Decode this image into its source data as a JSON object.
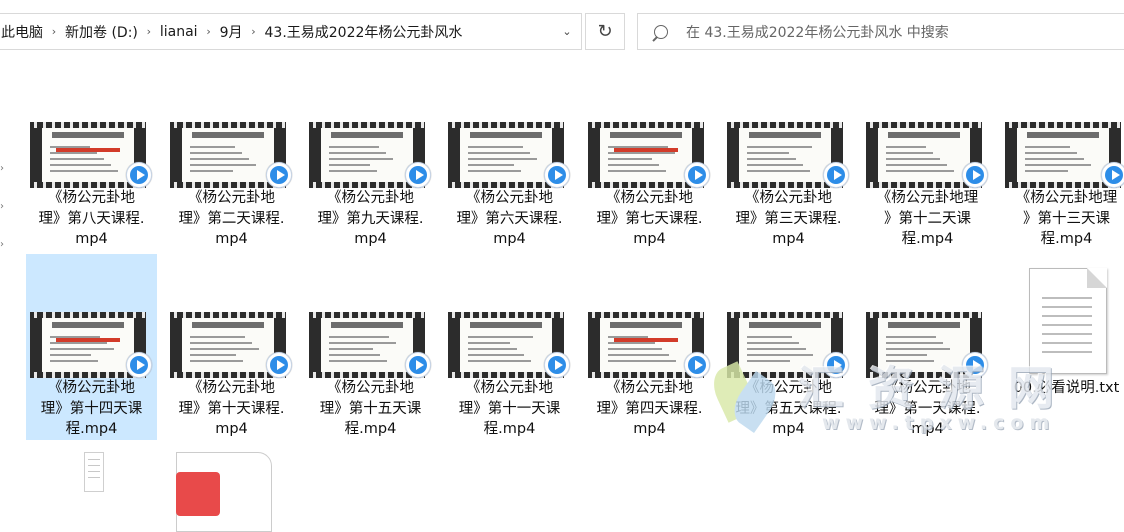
{
  "address_bar": {
    "breadcrumbs": [
      "此电脑",
      "新加卷 (D:)",
      "lianai",
      "9月",
      "43.王易成2022年杨公元卦风水"
    ],
    "breadcrumb_visible": [
      "此电脑",
      "新加卷 (D:)",
      "lianai",
      "9月",
      "43.王易成2022年杨公元卦风水"
    ]
  },
  "refresh_icon": "refresh-icon",
  "search": {
    "placeholder": "在 43.王易成2022年杨公元卦风水 中搜索"
  },
  "files": [
    {
      "name": "《杨公元卦地理》第八天课程.mp4",
      "lines": [
        "《杨公元卦地",
        "理》第八天课程.",
        "mp4"
      ],
      "type": "video"
    },
    {
      "name": "《杨公元卦地理》第二天课程.mp4",
      "lines": [
        "《杨公元卦地",
        "理》第二天课程.",
        "mp4"
      ],
      "type": "video"
    },
    {
      "name": "《杨公元卦地理》第九天课程.mp4",
      "lines": [
        "《杨公元卦地",
        "理》第九天课程.",
        "mp4"
      ],
      "type": "video"
    },
    {
      "name": "《杨公元卦地理》第六天课程.mp4",
      "lines": [
        "《杨公元卦地",
        "理》第六天课程.",
        "mp4"
      ],
      "type": "video"
    },
    {
      "name": "《杨公元卦地理》第七天课程.mp4",
      "lines": [
        "《杨公元卦地",
        "理》第七天课程.",
        "mp4"
      ],
      "type": "video"
    },
    {
      "name": "《杨公元卦地理》第三天课程.mp4",
      "lines": [
        "《杨公元卦地",
        "理》第三天课程.",
        "mp4"
      ],
      "type": "video"
    },
    {
      "name": "《杨公元卦地理》第十二天课程.mp4",
      "lines": [
        "《杨公元卦地理",
        "》第十二天课",
        "程.mp4"
      ],
      "type": "video"
    },
    {
      "name": "《杨公元卦地理》第十三天课程.mp4",
      "lines": [
        "《杨公元卦地理",
        "》第十三天课",
        "程.mp4"
      ],
      "type": "video"
    },
    {
      "name": "《杨公元卦地理》第十四天课程.mp4",
      "lines": [
        "《杨公元卦地",
        "理》第十四天课",
        "程.mp4"
      ],
      "type": "video",
      "selected": true
    },
    {
      "name": "《杨公元卦地理》第十天课程.mp4",
      "lines": [
        "《杨公元卦地",
        "理》第十天课程.",
        "mp4"
      ],
      "type": "video"
    },
    {
      "name": "《杨公元卦地理》第十五天课程.mp4",
      "lines": [
        "《杨公元卦地",
        "理》第十五天课",
        "程.mp4"
      ],
      "type": "video"
    },
    {
      "name": "《杨公元卦地理》第十一天课程.mp4",
      "lines": [
        "《杨公元卦地",
        "理》第十一天课",
        "程.mp4"
      ],
      "type": "video"
    },
    {
      "name": "《杨公元卦地理》第四天课程.mp4",
      "lines": [
        "《杨公元卦地",
        "理》第四天课程.",
        "mp4"
      ],
      "type": "video"
    },
    {
      "name": "《杨公元卦地理》第五天课程.mp4",
      "lines": [
        "《杨公元卦地",
        "理》第五天课程.",
        "mp4"
      ],
      "type": "video"
    },
    {
      "name": "《杨公元卦地理》第一天课程.mp4",
      "lines": [
        "《杨公元卦地",
        "理》第一天课程.",
        "mp4"
      ],
      "type": "video"
    },
    {
      "name": "00.必看说明.txt",
      "lines": [
        "00.必看说明.txt"
      ],
      "type": "text"
    }
  ],
  "thumbnail_slide_titles": [
    "元卦地理第三天用旨",
    "元卦猫发乾吉星任 佐吉二六大法"
  ],
  "colors": {
    "selection": "#cce8ff",
    "play_badge": "#2d8de8",
    "pdf_badge": "#e84a4a"
  },
  "icons": [
    "search-icon",
    "refresh-icon",
    "chevron-right-icon",
    "chevron-down-icon",
    "play-badge-icon",
    "text-file-icon",
    "pdf-file-icon"
  ]
}
